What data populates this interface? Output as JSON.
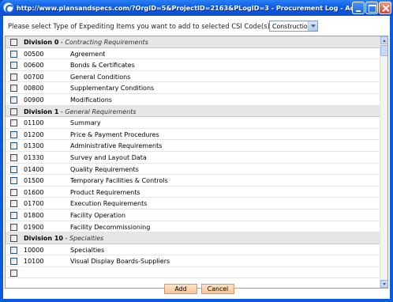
{
  "window": {
    "title": "http://www.plansandspecs.com/?OrgID=5&ProjectID=2163&PLogID=3 - Procurement Log - Add CSI Code - Windows ..."
  },
  "prompt": "Please select Type of Expediting Items you want to add to selected CSI Code(s)",
  "type_select": {
    "value": "Construction"
  },
  "list": [
    {
      "kind": "division",
      "name": "Division 0",
      "sub": "Contracting Requirements"
    },
    {
      "kind": "item",
      "code": "00500",
      "label": "Agreement"
    },
    {
      "kind": "item",
      "code": "00600",
      "label": "Bonds & Certificates"
    },
    {
      "kind": "item",
      "code": "00700",
      "label": "General Conditions"
    },
    {
      "kind": "item",
      "code": "00800",
      "label": "Supplementary Conditions"
    },
    {
      "kind": "item",
      "code": "00900",
      "label": "Modifications"
    },
    {
      "kind": "division",
      "name": "Division 1",
      "sub": "General Requirements"
    },
    {
      "kind": "item",
      "code": "01100",
      "label": "Summary"
    },
    {
      "kind": "item",
      "code": "01200",
      "label": "Price & Payment Procedures"
    },
    {
      "kind": "item",
      "code": "01300",
      "label": "Administrative Requirements"
    },
    {
      "kind": "item",
      "code": "01330",
      "label": "Survey and Layout Data"
    },
    {
      "kind": "item",
      "code": "01400",
      "label": "Quality Requirements"
    },
    {
      "kind": "item",
      "code": "01500",
      "label": "Temporary Facilities & Controls"
    },
    {
      "kind": "item",
      "code": "01600",
      "label": "Product Requirements"
    },
    {
      "kind": "item",
      "code": "01700",
      "label": "Execution Requirements"
    },
    {
      "kind": "item",
      "code": "01800",
      "label": "Facility Operation"
    },
    {
      "kind": "item",
      "code": "01900",
      "label": "Facility Decommissioning"
    },
    {
      "kind": "division",
      "name": "Division 10",
      "sub": "Specialties"
    },
    {
      "kind": "item",
      "code": "10000",
      "label": "Specialties"
    },
    {
      "kind": "item",
      "code": "10100",
      "label": "Visual Display Boards-Suppliers"
    },
    {
      "kind": "item",
      "code": "",
      "label": ""
    }
  ],
  "buttons": {
    "add": "Add",
    "cancel": "Cancel"
  }
}
